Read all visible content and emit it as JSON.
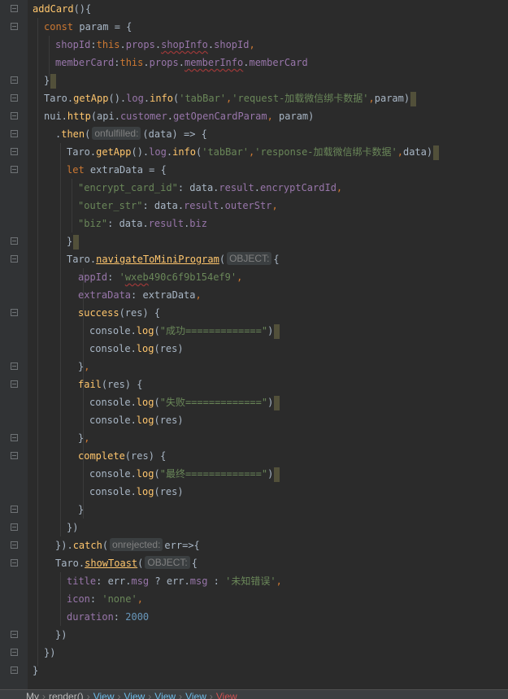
{
  "editor": {
    "language": "javascript",
    "code_lines": [
      "addCard(){",
      "const param = {",
      "shopId:this.props.shopInfo.shopId,",
      "memberCard:this.props.memberInfo.memberCard",
      "}",
      "Taro.getApp().log.info('tabBar','request-加载微信绑卡数据',param)",
      "nui.http(api.customer.getOpenCardParam, param)",
      ".then( onfulfilled: (data) => {",
      "Taro.getApp().log.info('tabBar','response-加载微信绑卡数据',data)",
      "let extraData = {",
      "\"encrypt_card_id\": data.result.encryptCardId,",
      "\"outer_str\": data.result.outerStr,",
      "\"biz\": data.result.biz",
      "}",
      "Taro.navigateToMiniProgram( OBJECT: {",
      "appId: 'wxeb490c6f9b154ef9',",
      "extraData: extraData,",
      "success(res) {",
      "console.log(\"成功=============\")",
      "console.log(res)",
      "},",
      "fail(res) {",
      "console.log(\"失败=============\")",
      "console.log(res)",
      "},",
      "complete(res) {",
      "console.log(\"最终=============\")",
      "console.log(res)",
      "}",
      "})",
      "}).catch( onrejected: err=>{",
      "Taro.showToast( OBJECT: {",
      "title: err.msg ? err.msg : '未知错误',",
      "icon: 'none',",
      "duration: 2000",
      "})",
      "})",
      "}"
    ],
    "hints": {
      "onfulfilled": "onfulfilled:",
      "object": "OBJECT:",
      "onrejected": "onrejected:"
    },
    "colors": {
      "background": "#2b2b2b",
      "gutter": "#313335",
      "keyword": "#cc7832",
      "function": "#ffc66d",
      "property": "#9876aa",
      "string": "#6a8759",
      "number": "#6897bb",
      "default": "#a9b7c6"
    }
  },
  "breadcrumb": {
    "items": [
      "My",
      "render()",
      "View",
      "View",
      "View",
      "View",
      "View"
    ]
  }
}
